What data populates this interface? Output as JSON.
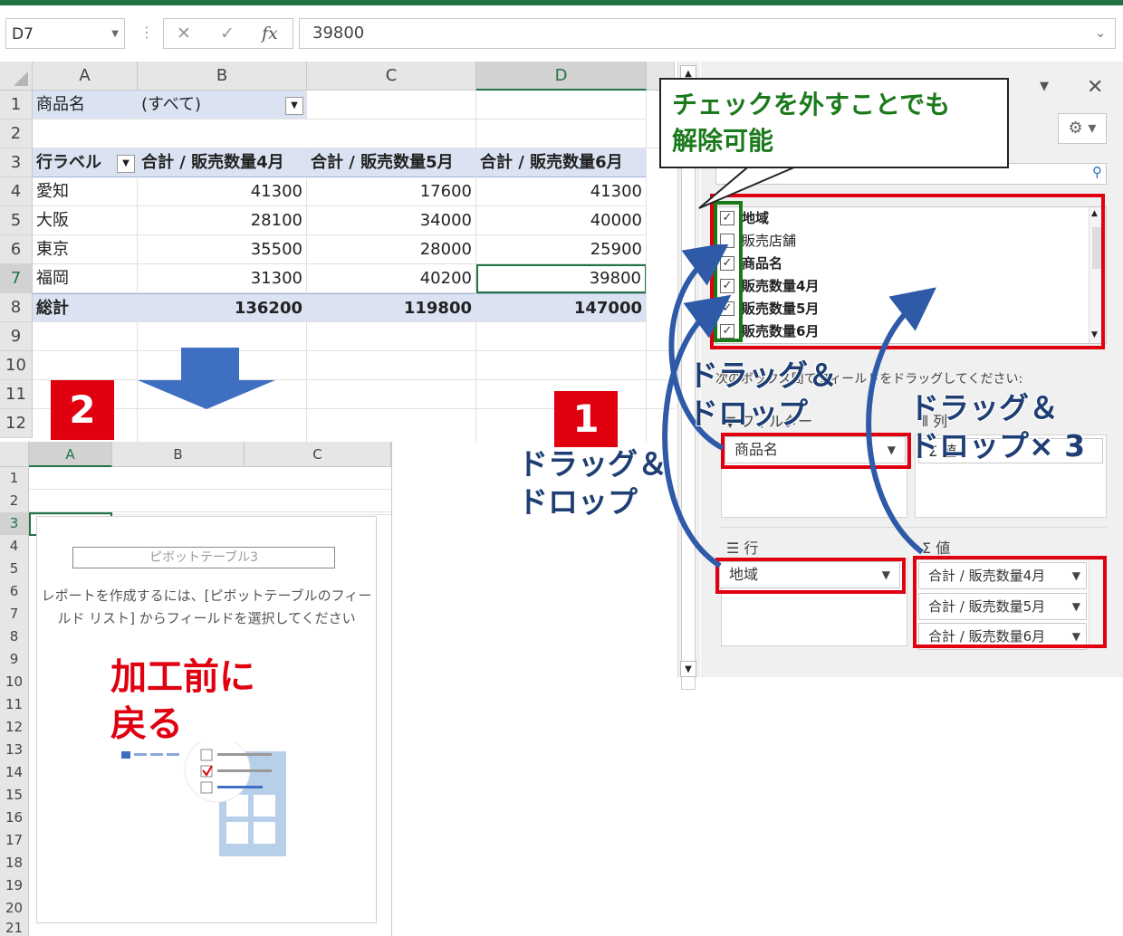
{
  "formula_bar": {
    "name_box": "D7",
    "value": "39800",
    "fx": "fx",
    "cancel": "✕",
    "enter": "✓"
  },
  "grid": {
    "columns": [
      "A",
      "B",
      "C",
      "D"
    ],
    "rows": [
      "1",
      "2",
      "3",
      "4",
      "5",
      "6",
      "7",
      "8",
      "9",
      "10",
      "11",
      "12"
    ],
    "filter": {
      "label": "商品名",
      "value": "(すべて)"
    },
    "header": {
      "row_label": "行ラベル",
      "c4": "合計 / 販売数量4月",
      "c5": "合計 / 販売数量5月",
      "c6": "合計 / 販売数量6月"
    },
    "data": [
      {
        "name": "愛知",
        "m4": "41300",
        "m5": "17600",
        "m6": "41300"
      },
      {
        "name": "大阪",
        "m4": "28100",
        "m5": "34000",
        "m6": "40000"
      },
      {
        "name": "東京",
        "m4": "35500",
        "m5": "28000",
        "m6": "25900"
      },
      {
        "name": "福岡",
        "m4": "31300",
        "m5": "40200",
        "m6": "39800"
      }
    ],
    "total": {
      "name": "総計",
      "m4": "136200",
      "m5": "119800",
      "m6": "147000"
    }
  },
  "pane": {
    "fields": [
      {
        "label": "地域",
        "checked": true,
        "bold": true
      },
      {
        "label": "販売店舗",
        "checked": false,
        "bold": false
      },
      {
        "label": "商品名",
        "checked": true,
        "bold": true
      },
      {
        "label": "販売数量4月",
        "checked": true,
        "bold": true
      },
      {
        "label": "販売数量5月",
        "checked": true,
        "bold": true
      },
      {
        "label": "販売数量6月",
        "checked": true,
        "bold": true
      }
    ],
    "instruction": "次のボックス間でフィールドをドラッグしてください:",
    "filter_area": "フィルター",
    "columns_area": "列",
    "rows_area": "行",
    "values_area": "値",
    "filter_pill": "商品名",
    "row_pill": "地域",
    "columns_pill": "Σ 値",
    "value_pills": [
      "合計 / 販売数量4月",
      "合計 / 販売数量5月",
      "合計 / 販売数量6月"
    ]
  },
  "callout": {
    "line1": "チェックを外すことでも",
    "line2": "解除可能"
  },
  "annotations": {
    "badge1": "1",
    "badge2": "2",
    "dnd1_line1": "ドラッグ＆",
    "dnd1_line2": "ドロップ",
    "dnd2_line1": "ドラッグ＆",
    "dnd2_line2": "ドロップ",
    "dnd3_line1": "ドラッグ＆",
    "dnd3_line2": "ドロップ× 3",
    "reset_line1": "加工前に",
    "reset_line2": "戻る"
  },
  "inset": {
    "columns": [
      "A",
      "B",
      "C"
    ],
    "rows": [
      "1",
      "2",
      "3",
      "4",
      "5",
      "6",
      "7",
      "8",
      "9",
      "10",
      "11",
      "12",
      "13",
      "14",
      "15",
      "16",
      "17",
      "18",
      "19",
      "20",
      "21"
    ],
    "pivot_name": "ピボットテーブル3",
    "instruction_line1": "レポートを作成するには、[ピボットテーブルのフィー",
    "instruction_line2": "ルド リスト] からフィールドを選択してください"
  },
  "colors": {
    "excel_green": "#217346",
    "highlight_red": "#e00010",
    "callout_green": "#1b7a1b",
    "arrow_blue": "#2f5aa8",
    "header_blue": "#dbe3f3"
  }
}
